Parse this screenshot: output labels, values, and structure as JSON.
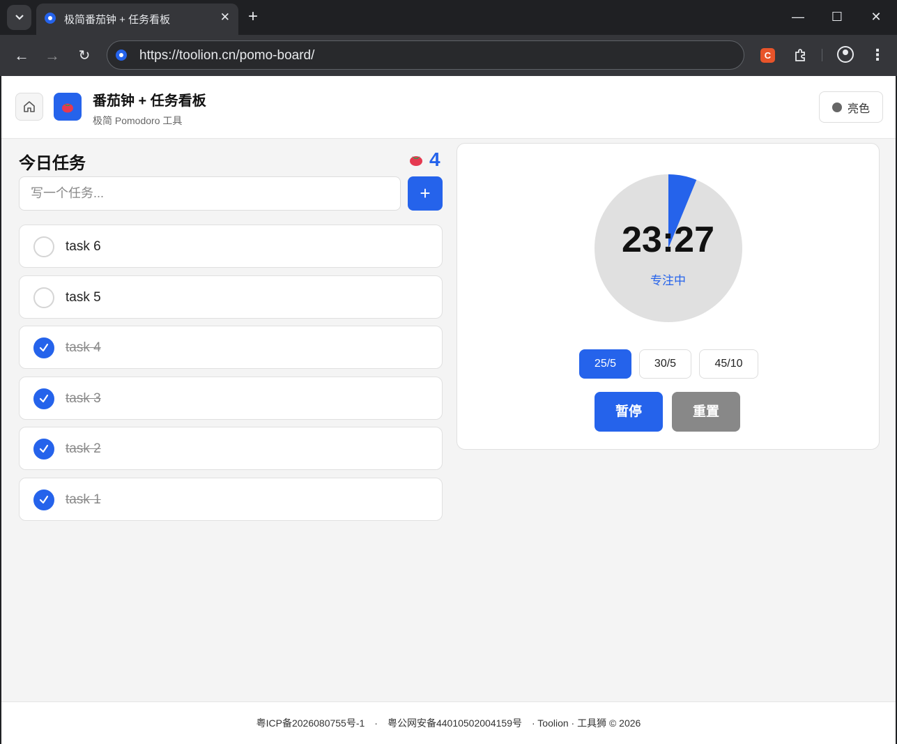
{
  "browser": {
    "tab_title": "极简番茄钟 + 任务看板",
    "url": "https://toolion.cn/pomo-board/"
  },
  "header": {
    "title": "番茄钟 + 任务看板",
    "subtitle": "极简 Pomodoro 工具",
    "theme_label": "亮色"
  },
  "tasks": {
    "title": "今日任务",
    "tomato_count": "4",
    "input_placeholder": "写一个任务...",
    "add_label": "+",
    "items": [
      {
        "label": "task 6",
        "done": false
      },
      {
        "label": "task 5",
        "done": false
      },
      {
        "label": "task 4",
        "done": true
      },
      {
        "label": "task 3",
        "done": true
      },
      {
        "label": "task 2",
        "done": true
      },
      {
        "label": "task 1",
        "done": true
      }
    ]
  },
  "timer": {
    "time": "23:27",
    "status": "专注中",
    "elapsed_fraction": 0.062,
    "presets": [
      "25/5",
      "30/5",
      "45/10"
    ],
    "active_preset": "25/5",
    "pause_label": "暂停",
    "reset_label": "重置"
  },
  "footer": {
    "icp": "粤ICP备2026080755号-1",
    "sep1": "·",
    "police": "粤公网安备44010502004159号",
    "brand": "· Toolion · 工具狮 © 2026"
  },
  "colors": {
    "accent": "#2563eb",
    "ring_bg": "#e0e0e0",
    "reset_gray": "#888888"
  }
}
